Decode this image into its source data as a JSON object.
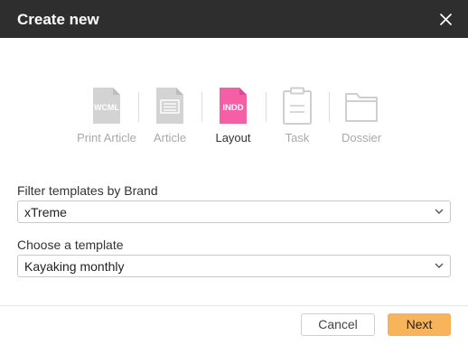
{
  "dialog": {
    "title": "Create new",
    "close_icon": "close-icon"
  },
  "types": [
    {
      "label": "Print Article",
      "icon": "wcml-file-icon",
      "badge": "WCML",
      "active": false
    },
    {
      "label": "Article",
      "icon": "article-file-icon",
      "active": false
    },
    {
      "label": "Layout",
      "icon": "indd-file-icon",
      "badge": "INDD",
      "active": true,
      "color": "#f45fa6"
    },
    {
      "label": "Task",
      "icon": "clipboard-icon",
      "active": false
    },
    {
      "label": "Dossier",
      "icon": "folder-icon",
      "active": false
    }
  ],
  "brand_filter": {
    "label": "Filter templates by Brand",
    "value": "xTreme"
  },
  "template": {
    "label": "Choose a template",
    "value": "Kayaking monthly"
  },
  "footer": {
    "cancel_label": "Cancel",
    "next_label": "Next",
    "next_color": "#f7b45a"
  }
}
